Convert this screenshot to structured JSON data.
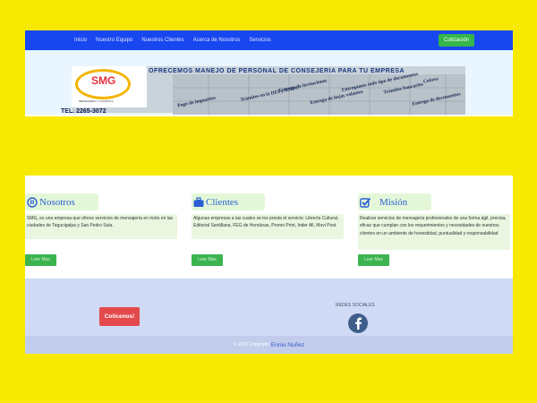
{
  "navbar": {
    "links": [
      "Inicio",
      "Nuestro Equipo",
      "Nuestros Clientes",
      "Acerca de Nosotros",
      "Servicios"
    ],
    "quote_button": "Cotización"
  },
  "banner": {
    "headline": "OFRECEMOS MANEJO DE PERSONAL DE CONSEJERIA PARA TU EMPRESA",
    "logo_text": "SMG",
    "logo_subtitle": "MENSAJERIA Y LOGISTICA",
    "phone": "TEL. 2265-3072",
    "puzzle_texts": [
      "Pago de impuestos",
      "Trámites en la DEI y AMDC",
      "Entrega de invitaciones",
      "Entrega de hojas volantes",
      "Entregamos todo tipo de documentos",
      "Trámites bancarios",
      "Cobros",
      "Entrega de documentos"
    ]
  },
  "columns": [
    {
      "icon": "registered-icon",
      "title": "Nosotros",
      "body": "SMG, es una empresa que ofrece servicios de mensajería en moto en las ciudades de Tegucigalpa y San Pedro Sula.",
      "button": "Leer Mas"
    },
    {
      "icon": "briefcase-icon",
      "title": "Clientes",
      "body": "Algunas empresas a las cuales se les presta el servicio: Librería Cultural, Editorial Santillana, FEG de Honduras, Promo Print, Inder All, Movi Post.",
      "button": "Leer Mas"
    },
    {
      "icon": "checkbox-icon",
      "title": "Misión",
      "body": "Realizar servicios de mensajería profesionales de una forma ágil, precisa, eficaz que cumplan con los requerimientos y necesidades de nuestros clientes en un ambiente de honestidad, puntualidad y responsabilidad",
      "button": "Leer Mas"
    }
  ],
  "footer": {
    "contact_button": "Cotícenos!",
    "social_label": "REDES SOCIALES",
    "copyright": "© 2016 Copyright",
    "author": "Ennio Nuñez"
  },
  "colors": {
    "background": "#f7ea00",
    "navbar": "#1847f0",
    "primary_green": "#3bb34f",
    "contact_red": "#e34a4c",
    "footer": "#d0daf5",
    "facebook": "#3f5f8a"
  }
}
